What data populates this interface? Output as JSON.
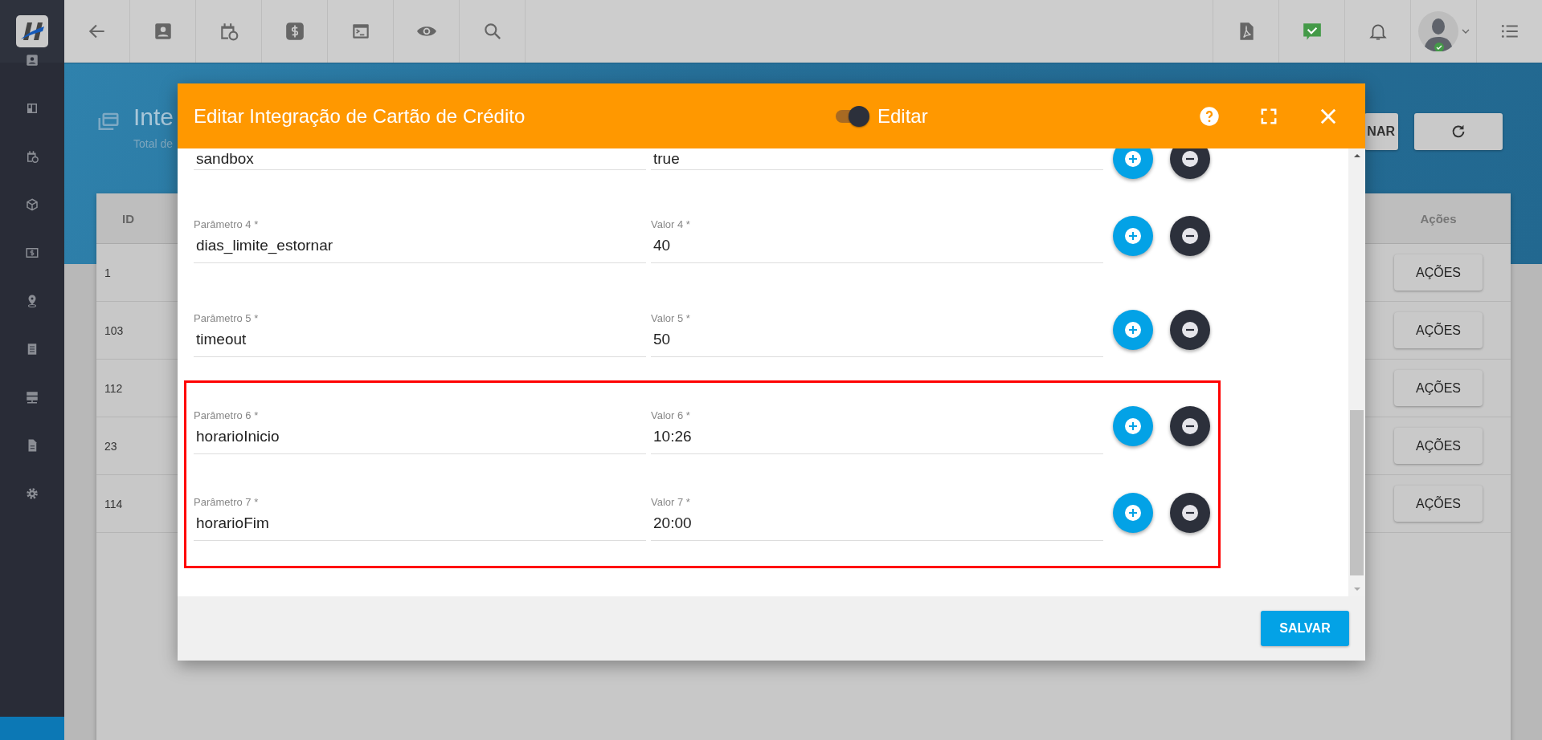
{
  "page": {
    "title": "Inte",
    "subtitle": "Total de",
    "add_button": "NAR"
  },
  "table": {
    "columns": [
      "ID",
      "Ações"
    ],
    "rows": [
      {
        "id": "1",
        "action": "AÇÕES"
      },
      {
        "id": "103",
        "action": "AÇÕES"
      },
      {
        "id": "112",
        "action": "AÇÕES"
      },
      {
        "id": "23",
        "action": "AÇÕES"
      },
      {
        "id": "114",
        "action": "AÇÕES"
      }
    ]
  },
  "dialog": {
    "title": "Editar Integração de Cartão de Crédito",
    "edit_toggle": {
      "label": "Editar",
      "on": true
    },
    "rows": [
      {
        "param": "sandbox",
        "value": "true",
        "highlighted": false
      },
      {
        "param_label": "Parâmetro 4 *",
        "param": "dias_limite_estornar",
        "value_label": "Valor 4 *",
        "value": "40",
        "highlighted": false
      },
      {
        "param_label": "Parâmetro 5 *",
        "param": "timeout",
        "value_label": "Valor 5 *",
        "value": "50",
        "highlighted": false
      },
      {
        "param_label": "Parâmetro 6 *",
        "param": "horarioInicio",
        "value_label": "Valor 6 *",
        "value": "10:26",
        "highlighted": true
      },
      {
        "param_label": "Parâmetro 7 *",
        "param": "horarioFim",
        "value_label": "Valor 7 *",
        "value": "20:00",
        "highlighted": true
      }
    ],
    "save_button": "SALVAR"
  }
}
